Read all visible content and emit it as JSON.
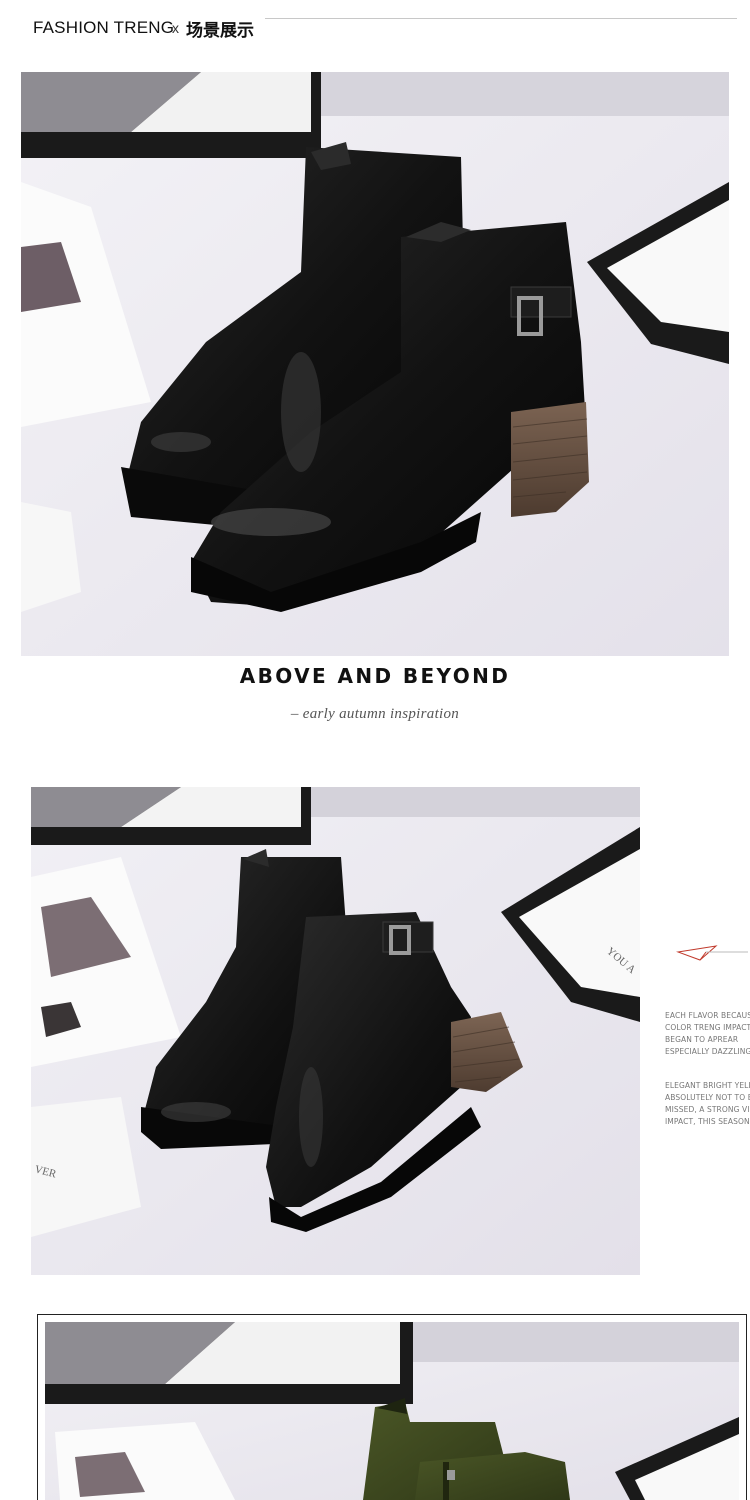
{
  "header": {
    "brand": "FASHION TRENG",
    "separator": "x",
    "section_cn": "场景展示"
  },
  "tagline": {
    "title": "ABOVE AND BEYOND",
    "subtitle": "– early autumn inspiration"
  },
  "side_text": {
    "block1": [
      "EACH FLAVOR BECAUSE",
      "COLOR TRENG IMPACT",
      "BEGAN TO APREAR",
      "ESPECIALLY DAZZLING"
    ],
    "block2": [
      "ELEGANT BRIGHT YELLO",
      "ABSOLUTELY NOT TO BE",
      "MISSED, A STRONG VISI",
      "IMPACT, THIS SEASON"
    ]
  },
  "photos": {
    "photo1": "black-leather-ankle-boots-pair",
    "photo2": "black-leather-ankle-boots-side",
    "photo3": "green-suede-ankle-boots"
  },
  "colors": {
    "backdrop": "#e8e6ee",
    "leather": "#141414",
    "heel": "#6b5443",
    "suede": "#3f4a1f",
    "frame": "#1a1a1a"
  }
}
